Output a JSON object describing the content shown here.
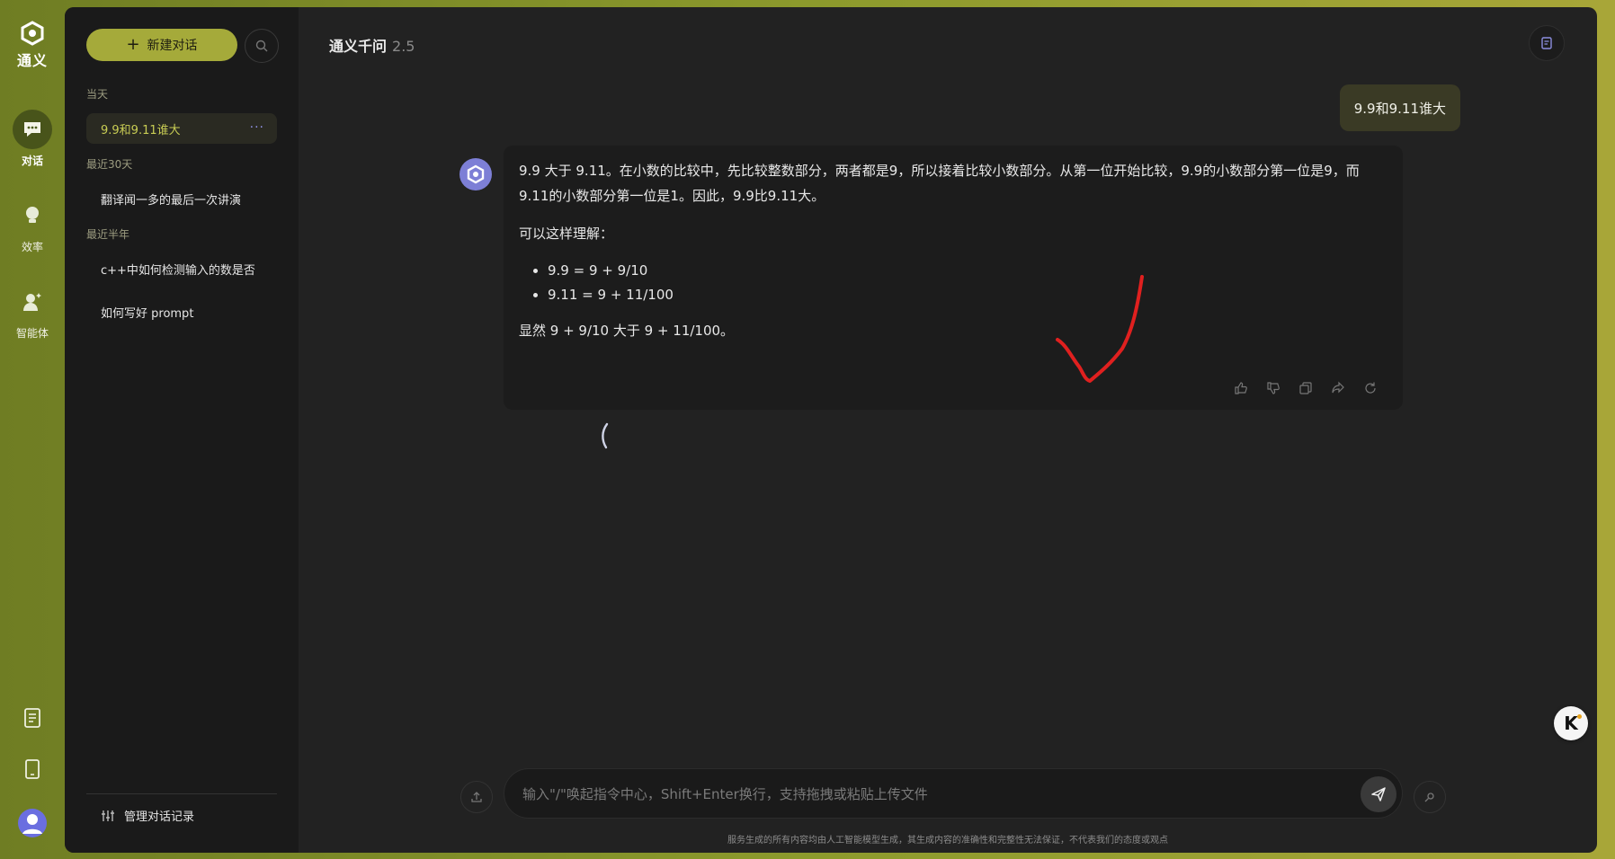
{
  "rail": {
    "logo_text": "通义",
    "items": [
      {
        "label": "对话",
        "icon": "chat-bubble-icon",
        "active": true
      },
      {
        "label": "效率",
        "icon": "lightbulb-icon",
        "active": false
      },
      {
        "label": "智能体",
        "icon": "agent-icon",
        "active": false
      }
    ],
    "bottom_icons": [
      "document-icon",
      "phone-icon",
      "avatar"
    ]
  },
  "sidebar": {
    "new_chat_label": "新建对话",
    "groups": [
      {
        "label": "当天",
        "items": [
          {
            "title": "9.9和9.11谁大",
            "active": true,
            "more": "···"
          }
        ]
      },
      {
        "label": "最近30天",
        "items": [
          {
            "title": "翻译闻一多的最后一次讲演",
            "active": false
          }
        ]
      },
      {
        "label": "最近半年",
        "items": [
          {
            "title": "c++中如何检测输入的数是否",
            "active": false
          },
          {
            "title": "如何写好 prompt",
            "active": false
          }
        ]
      }
    ],
    "manage_label": "管理对话记录"
  },
  "header": {
    "title": "通义千问",
    "version": "2.5"
  },
  "conversation": {
    "user_message": "9.9和9.11谁大",
    "bot_paragraph_1": "9.9 大于 9.11。在小数的比较中，先比较整数部分，两者都是9，所以接着比较小数部分。从第一位开始比较，9.9的小数部分第一位是9，而9.11的小数部分第一位是1。因此，9.9比9.11大。",
    "bot_paragraph_2": "可以这样理解：",
    "bot_list": [
      "9.9 = 9 + 9/10",
      "9.11 = 9 + 11/100"
    ],
    "bot_paragraph_3": "显然 9 + 9/10 大于 9 + 11/100。"
  },
  "input": {
    "placeholder": "输入\"/\"唤起指令中心，Shift+Enter换行，支持拖拽或粘贴上传文件"
  },
  "footer": {
    "disclaimer": "服务生成的所有内容均由人工智能模型生成，其生成内容的准确性和完整性无法保证，不代表我们的态度或观点"
  },
  "floating": {
    "label": "K"
  },
  "colors": {
    "accent": "#a5aa3a",
    "annotation": "#e0201f",
    "bot_avatar": "#7d7fd6"
  }
}
